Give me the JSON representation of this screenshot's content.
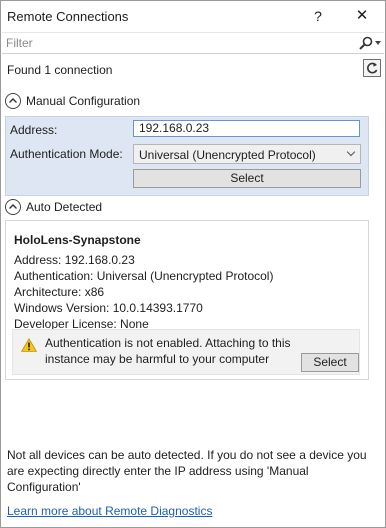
{
  "window": {
    "title": "Remote Connections",
    "help_label": "?",
    "close_label": "✕"
  },
  "filter": {
    "placeholder": "Filter",
    "search_icon": "search-icon"
  },
  "status": {
    "found_text": "Found 1 connection",
    "refresh_icon": "refresh-icon"
  },
  "manual": {
    "header": "Manual Configuration",
    "address_label": "Address:",
    "address_value": "192.168.0.23",
    "auth_label": "Authentication Mode:",
    "auth_value": "Universal (Unencrypted Protocol)",
    "select_label": "Select"
  },
  "auto": {
    "header": "Auto Detected",
    "device": {
      "name": "HoloLens-Synapstone",
      "address": "Address:  192.168.0.23",
      "authentication": "Authentication: Universal (Unencrypted Protocol)",
      "architecture": "Architecture: x86",
      "windows_version": "Windows Version: 10.0.14393.1770",
      "developer_license": "Developer License: None",
      "warning": "Authentication is not enabled. Attaching to this instance may be harmful to your computer",
      "select_label": "Select"
    }
  },
  "footer": {
    "note": "Not all devices can be auto detected. If you do not see a device you are expecting directly enter the IP address using 'Manual Configuration'",
    "link": "Learn more about Remote Diagnostics"
  },
  "colors": {
    "panel_bg": "#dde6f2",
    "link": "#1a5fb4",
    "warning": "#f5c518"
  }
}
